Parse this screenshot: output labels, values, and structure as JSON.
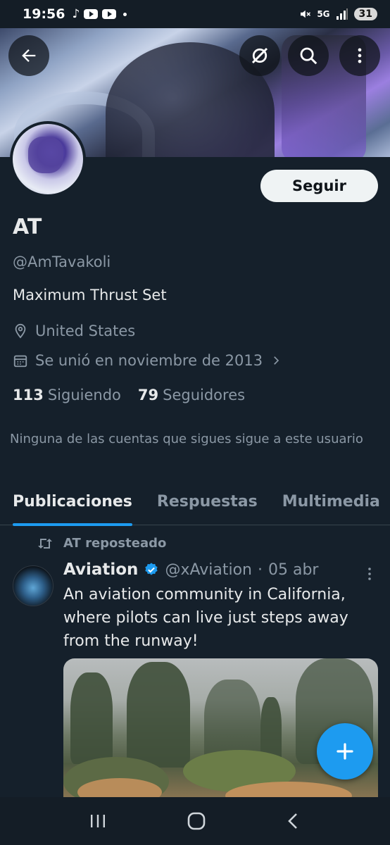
{
  "status_bar": {
    "time": "19:56",
    "network": "5G",
    "battery": "31"
  },
  "banner": {
    "back_icon": "arrow-left-icon",
    "grok_icon": "grok-icon",
    "search_icon": "search-icon",
    "more_icon": "more-vertical-icon"
  },
  "profile": {
    "follow_label": "Seguir",
    "display_name": "AT",
    "handle": "@AmTavakoli",
    "bio": "Maximum Thrust Set",
    "location": "United States",
    "joined": "Se unió en noviembre de 2013",
    "following_count": "113",
    "following_label": "Siguiendo",
    "followers_count": "79",
    "followers_label": "Seguidores",
    "followers_note": "Ninguna de las cuentas que sigues sigue a este usuario"
  },
  "tabs": [
    {
      "label": "Publicaciones",
      "active": true
    },
    {
      "label": "Respuestas",
      "active": false
    },
    {
      "label": "Multimedia",
      "active": false
    }
  ],
  "post": {
    "repost_label": "AT reposteado",
    "author_name": "Aviation",
    "author_handle": "@xAviation",
    "separator": "·",
    "date": "05 abr",
    "text": "An aviation community in California, where pilots can live just steps away from the runway!"
  },
  "colors": {
    "background": "#15202b",
    "accent": "#1d9bf0",
    "verified": "#1d9bf0",
    "secondary_text": "#8b98a5"
  }
}
